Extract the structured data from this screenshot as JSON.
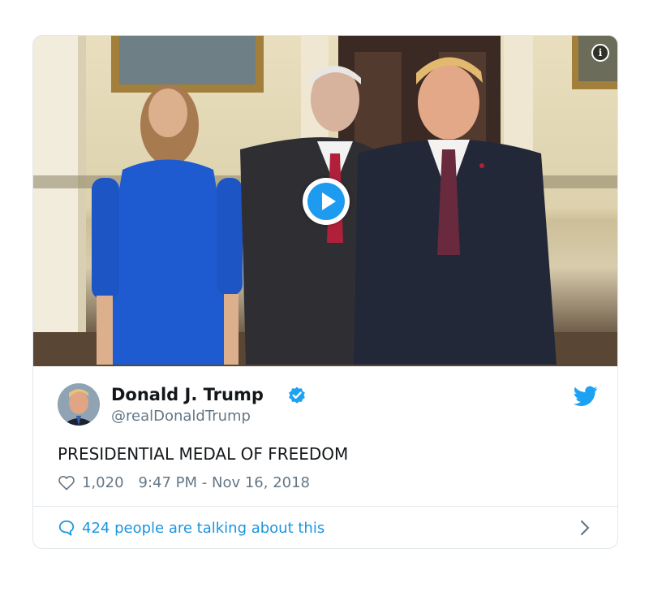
{
  "tweet": {
    "author": {
      "name": "Donald J. Trump",
      "handle": "@realDonaldTrump",
      "verified": true
    },
    "text": "PRESIDENTIAL MEDAL OF FREEDOM",
    "likes": "1,020",
    "timestamp": "9:47 PM - Nov 16, 2018",
    "conversation": "424 people are talking about this",
    "media": {
      "type": "video",
      "icons": [
        "play-icon",
        "info-icon"
      ]
    }
  },
  "icons": {
    "brand": "twitter-bird-icon",
    "verified": "verified-badge-icon",
    "like": "heart-icon",
    "reply": "speech-bubble-icon",
    "open": "chevron-right-icon"
  },
  "colors": {
    "accent": "#1b95e0",
    "verified": "#1da1f2",
    "muted_text": "#657786",
    "border": "#e1e8ed"
  }
}
